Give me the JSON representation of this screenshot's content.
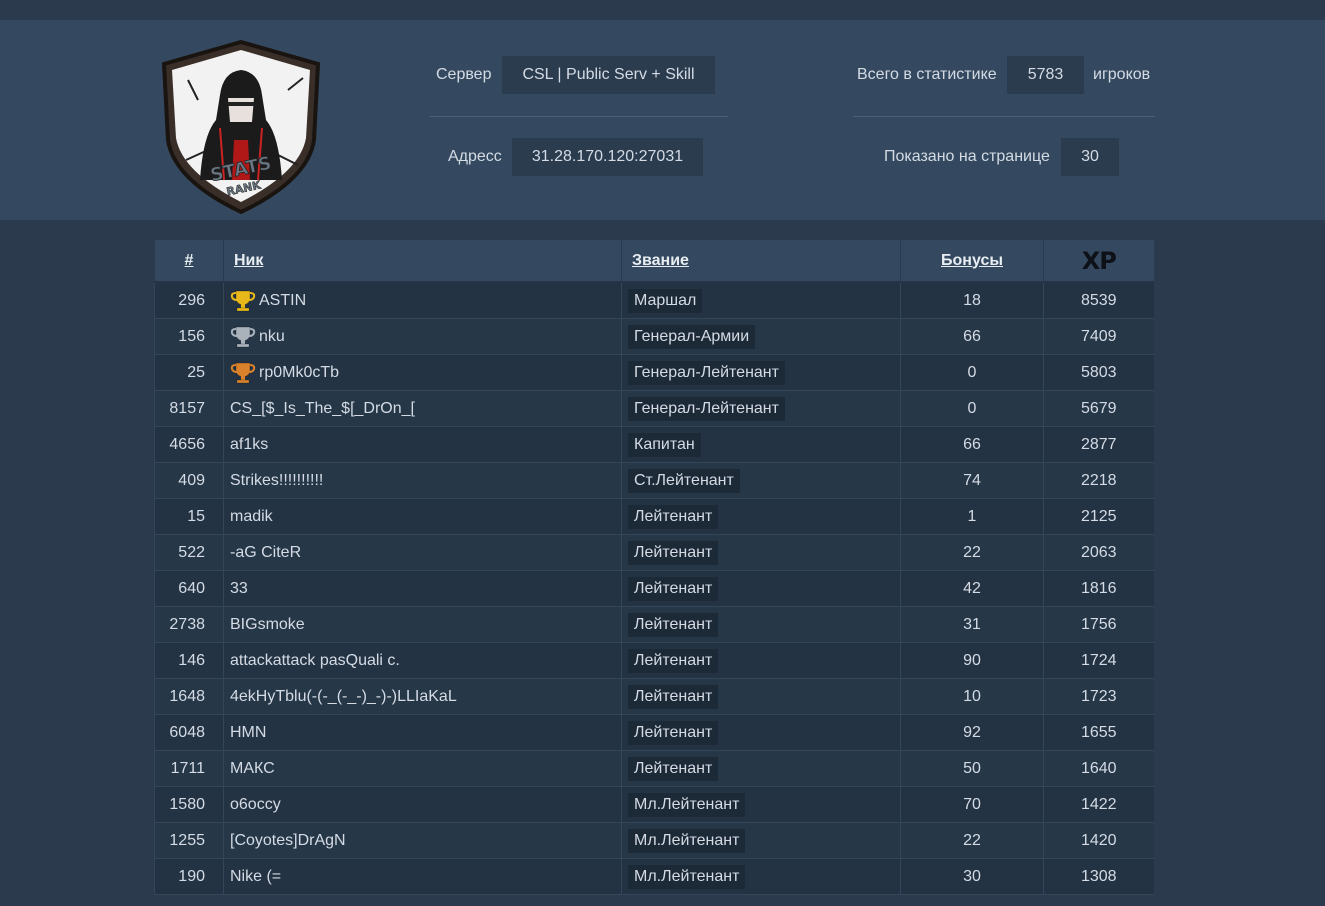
{
  "header": {
    "server_label": "Сервер",
    "server_value": "CSL | Public Serv + Skill",
    "address_label": "Адресс",
    "address_value": "31.28.170.120:27031",
    "total_label": "Всего в статистике",
    "total_value": "5783",
    "total_suffix": "игроков",
    "per_page_label": "Показано на странице",
    "per_page_value": "30",
    "logo_text_1": "STATS",
    "logo_text_2": "RANK"
  },
  "table": {
    "columns": [
      "#",
      "Ник",
      "Звание",
      "Бонусы",
      "XP"
    ],
    "rows": [
      {
        "id": "296",
        "nick": "ASTIN",
        "rank": "Маршал",
        "bonus": "18",
        "xp": "8539",
        "trophy": "gold"
      },
      {
        "id": "156",
        "nick": "nku",
        "rank": "Генерал-Армии",
        "bonus": "66",
        "xp": "7409",
        "trophy": "silver"
      },
      {
        "id": "25",
        "nick": "rp0Mk0cTb",
        "rank": "Генерал-Лейтенант",
        "bonus": "0",
        "xp": "5803",
        "trophy": "bronze"
      },
      {
        "id": "8157",
        "nick": "CS_[$_Is_The_$[_DrOn_[",
        "rank": "Генерал-Лейтенант",
        "bonus": "0",
        "xp": "5679",
        "trophy": ""
      },
      {
        "id": "4656",
        "nick": "af1ks",
        "rank": "Капитан",
        "bonus": "66",
        "xp": "2877",
        "trophy": ""
      },
      {
        "id": "409",
        "nick": "Strikes!!!!!!!!!!",
        "rank": "Ст.Лейтенант",
        "bonus": "74",
        "xp": "2218",
        "trophy": ""
      },
      {
        "id": "15",
        "nick": "madik",
        "rank": "Лейтенант",
        "bonus": "1",
        "xp": "2125",
        "trophy": ""
      },
      {
        "id": "522",
        "nick": "-aG CiteR",
        "rank": "Лейтенант",
        "bonus": "22",
        "xp": "2063",
        "trophy": ""
      },
      {
        "id": "640",
        "nick": "33",
        "rank": "Лейтенант",
        "bonus": "42",
        "xp": "1816",
        "trophy": ""
      },
      {
        "id": "2738",
        "nick": "BIGsmoke",
        "rank": "Лейтенант",
        "bonus": "31",
        "xp": "1756",
        "trophy": ""
      },
      {
        "id": "146",
        "nick": "attackattack pasQuali c.",
        "rank": "Лейтенант",
        "bonus": "90",
        "xp": "1724",
        "trophy": ""
      },
      {
        "id": "1648",
        "nick": "4ekHyTblu(-(-_(-_-)_-)-)LLIaKaL",
        "rank": "Лейтенант",
        "bonus": "10",
        "xp": "1723",
        "trophy": ""
      },
      {
        "id": "6048",
        "nick": "HMN",
        "rank": "Лейтенант",
        "bonus": "92",
        "xp": "1655",
        "trophy": ""
      },
      {
        "id": "1711",
        "nick": "МАКС",
        "rank": "Лейтенант",
        "bonus": "50",
        "xp": "1640",
        "trophy": ""
      },
      {
        "id": "1580",
        "nick": "o6occy",
        "rank": "Мл.Лейтенант",
        "bonus": "70",
        "xp": "1422",
        "trophy": ""
      },
      {
        "id": "1255",
        "nick": "[Coyotes]DrAgN",
        "rank": "Мл.Лейтенант",
        "bonus": "22",
        "xp": "1420",
        "trophy": ""
      },
      {
        "id": "190",
        "nick": "Nike (=",
        "rank": "Мл.Лейтенант",
        "bonus": "30",
        "xp": "1308",
        "trophy": ""
      }
    ]
  },
  "colors": {
    "background": "#2b3a4d",
    "header_band": "#34495f",
    "gold": "#e8b81a",
    "silver": "#a9b1bb",
    "bronze": "#d9822b"
  }
}
